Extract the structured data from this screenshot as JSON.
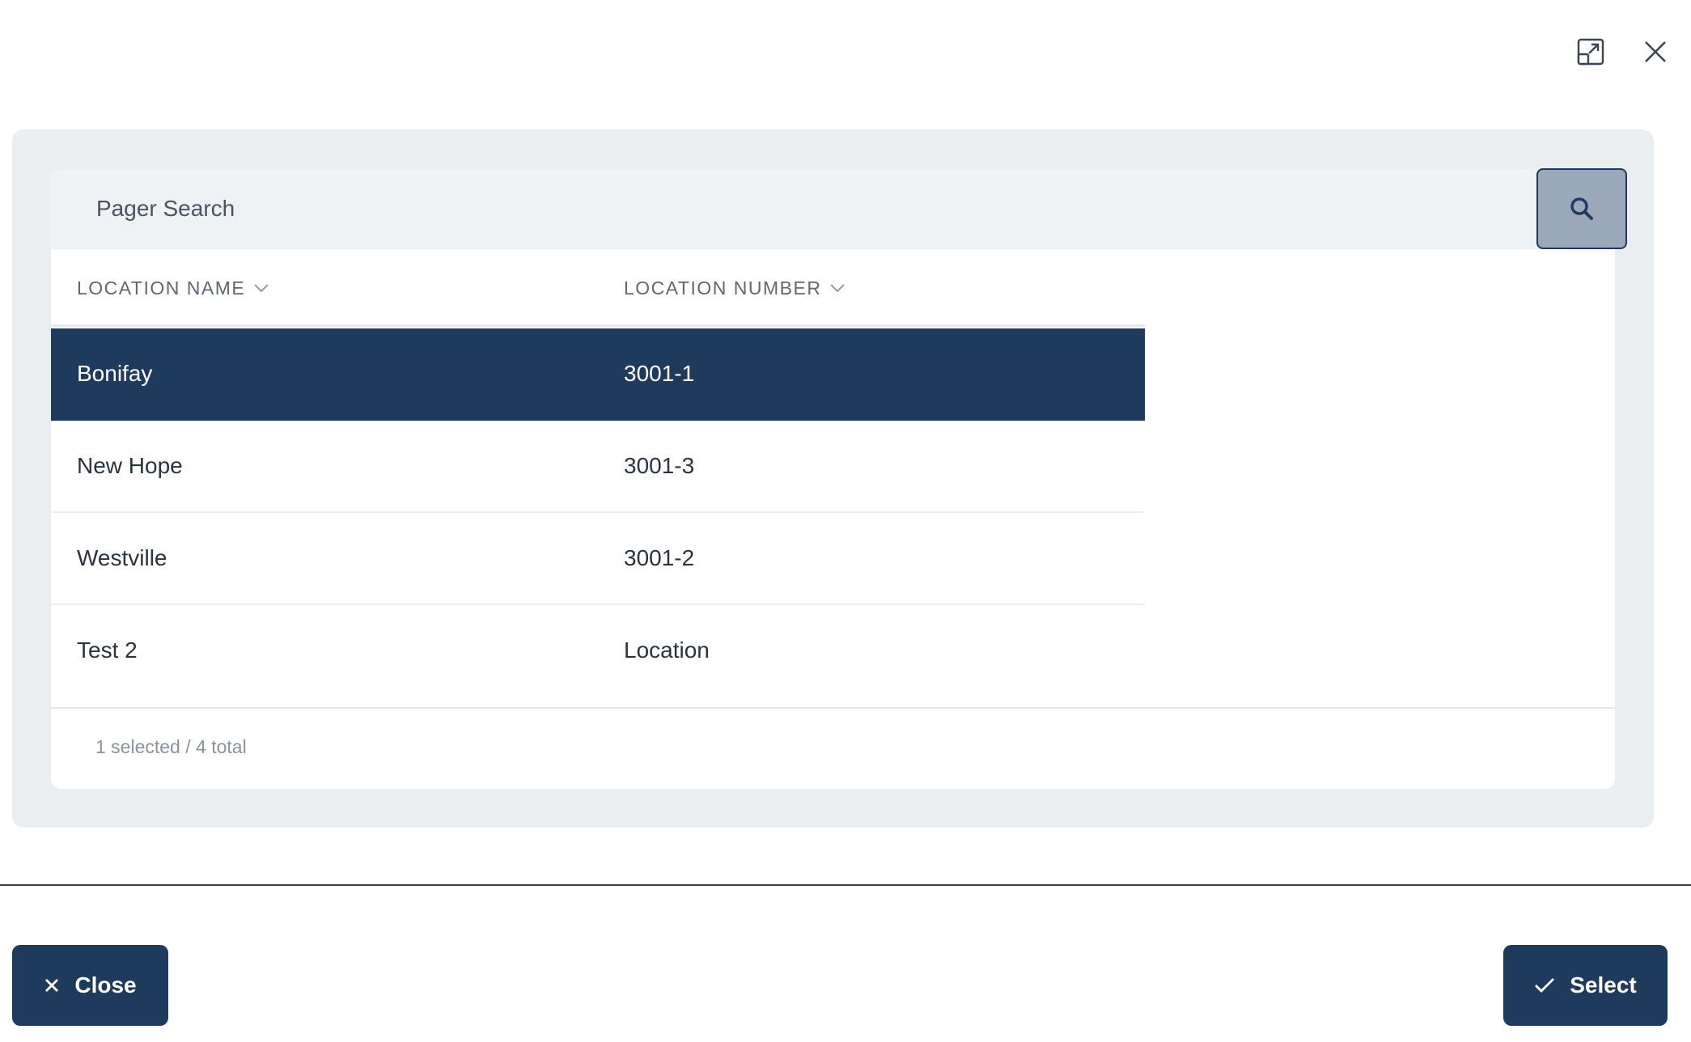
{
  "window_controls": {
    "expand_icon": "expand-icon",
    "close_icon": "close-icon"
  },
  "search": {
    "placeholder": "Pager Search",
    "button_icon": "search-icon"
  },
  "table": {
    "columns": [
      {
        "label": "LOCATION NAME",
        "sort_icon": "chevron-down-icon"
      },
      {
        "label": "LOCATION NUMBER",
        "sort_icon": "chevron-down-icon"
      }
    ],
    "rows": [
      {
        "name": "Bonifay",
        "number": "3001-1",
        "selected": true
      },
      {
        "name": "New Hope",
        "number": "3001-3",
        "selected": false
      },
      {
        "name": "Westville",
        "number": "3001-2",
        "selected": false
      },
      {
        "name": "Test 2",
        "number": "Location",
        "selected": false
      }
    ],
    "footer": "1 selected / 4 total"
  },
  "actions": {
    "close_label": "Close",
    "select_label": "Select"
  },
  "colors": {
    "primary": "#1e3a5c",
    "panel_bg": "#ebeef1",
    "search_button_bg": "#9aa8ba"
  }
}
